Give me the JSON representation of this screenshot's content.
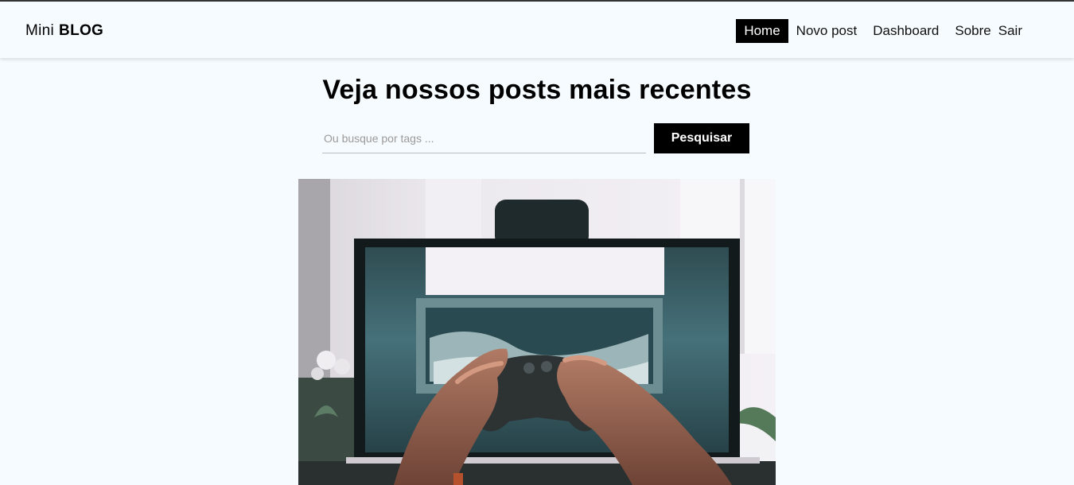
{
  "brand": {
    "prefix": "Mini",
    "name": "BLOG"
  },
  "nav": [
    {
      "label": "Home",
      "active": true
    },
    {
      "label": "Novo post",
      "active": false
    },
    {
      "label": "Dashboard",
      "active": false
    },
    {
      "label": "Sobre",
      "active": false
    },
    {
      "label": "Sair",
      "active": false
    }
  ],
  "page": {
    "title": "Veja nossos posts mais recentes"
  },
  "search": {
    "placeholder": "Ou busque por tags ...",
    "value": "",
    "button_label": "Pesquisar"
  },
  "post": {
    "image": "photo of hands holding a game controller in front of a monitor"
  },
  "colors": {
    "background": "#f6fbff",
    "accent": "#000000",
    "text": "#000000"
  }
}
